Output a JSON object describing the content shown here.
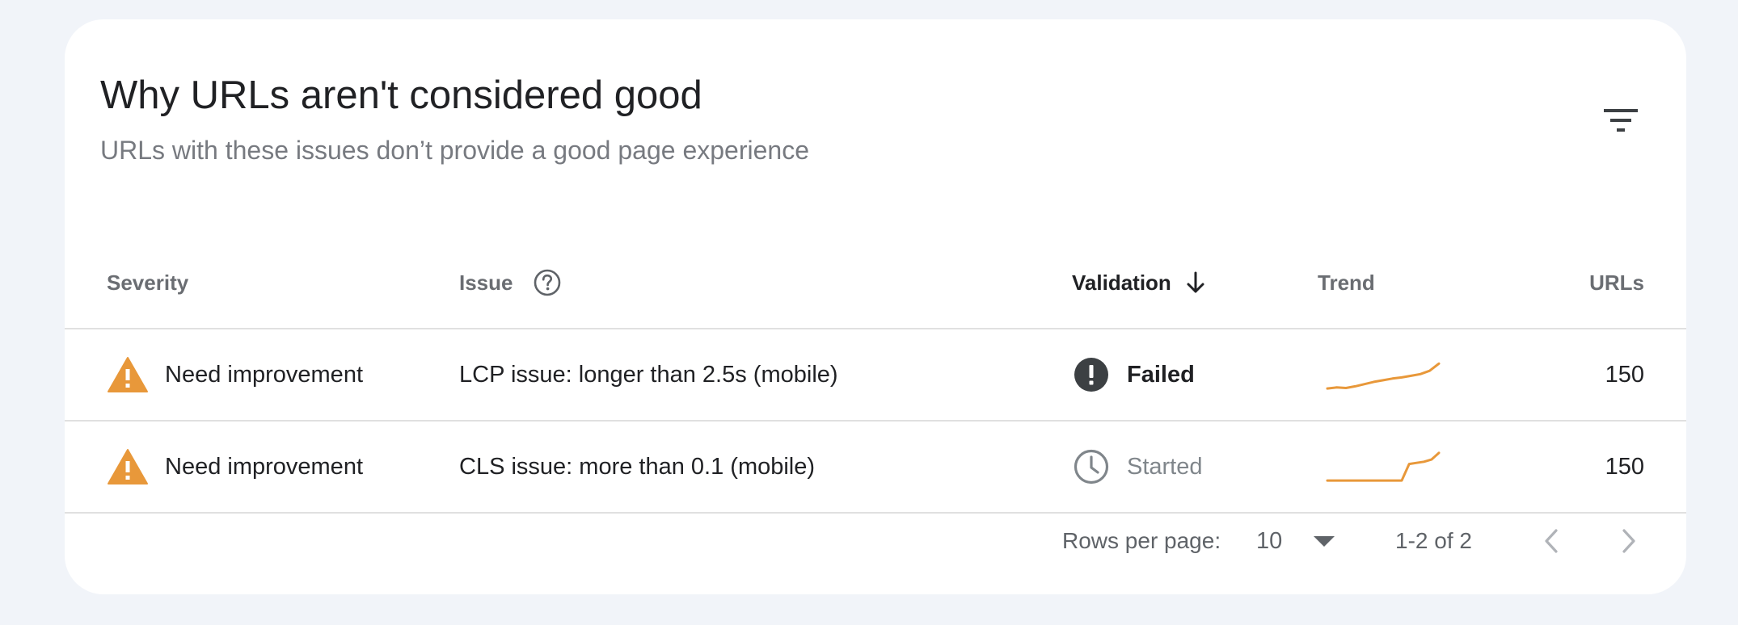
{
  "card": {
    "title": "Why URLs aren't considered good",
    "subtitle": "URLs with these issues don’t provide a good page experience",
    "filter_icon": "filter-icon"
  },
  "table": {
    "columns": {
      "severity": "Severity",
      "issue": "Issue",
      "validation": "Validation",
      "trend": "Trend",
      "urls": "URLs"
    },
    "sort": {
      "column": "validation",
      "direction": "descending",
      "icon": "arrow-down-icon"
    },
    "rows": [
      {
        "severity": "Need improvement",
        "severity_icon": "warning-icon",
        "issue": "LCP issue: longer than 2.5s (mobile)",
        "validation": "Failed",
        "validation_icon": "error-icon",
        "trend": [
          40,
          42,
          41,
          44,
          48,
          52,
          55,
          58,
          60,
          63,
          66,
          72,
          85
        ],
        "urls": "150"
      },
      {
        "severity": "Need improvement",
        "severity_icon": "warning-icon",
        "issue": "CLS issue: more than 0.1 (mobile)",
        "validation": "Started",
        "validation_icon": "clock-icon",
        "trend": [
          40,
          40,
          40,
          40,
          40,
          40,
          40,
          40,
          40,
          40,
          40,
          70,
          72,
          74,
          78,
          90
        ],
        "urls": "150"
      }
    ]
  },
  "pagination": {
    "rows_per_page_label": "Rows per page:",
    "rows_per_page_value": "10",
    "range": "1-2 of 2"
  },
  "colors": {
    "warning": "#e8983a",
    "trend": "#e8983a",
    "failed_icon": "#3c4043",
    "started_icon": "#80868b",
    "background": "#f1f4f9",
    "card": "#ffffff"
  }
}
